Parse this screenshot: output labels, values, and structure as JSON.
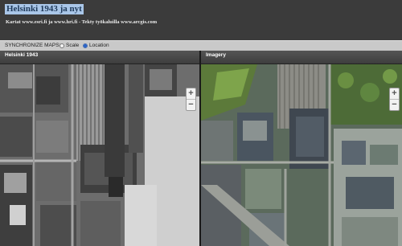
{
  "header": {
    "title": "Helsinki 1943 ja nyt",
    "subtitle": "Kartat www.esri.fi ja www.hri.fi - Tekty työkaluilla www.arcgis.com"
  },
  "sync": {
    "label": "SYNCHRONIZE MAPS:",
    "options": [
      {
        "label": "Scale",
        "selected": false
      },
      {
        "label": "Location",
        "selected": true
      }
    ]
  },
  "panels": {
    "left": {
      "title": "Helsinki 1943",
      "zoom_in": "+",
      "zoom_out": "−"
    },
    "right": {
      "title": "Imagery",
      "zoom_in": "+",
      "zoom_out": "−"
    }
  }
}
